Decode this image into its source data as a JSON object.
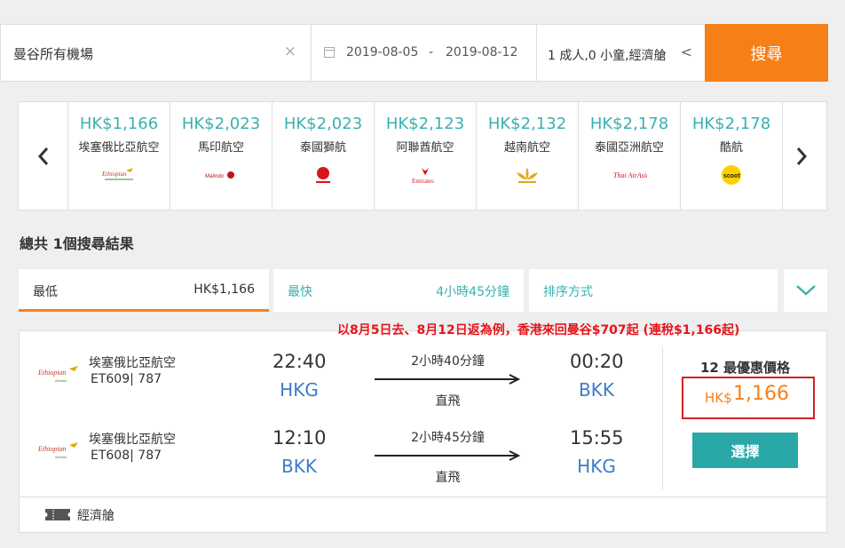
{
  "search": {
    "destination": "曼谷所有機場",
    "clear_symbol": "×",
    "date_from": "2019-08-05",
    "date_separator": "-",
    "date_to": "2019-08-12",
    "passengers": "1 成人,0 小童,經濟艙",
    "passengers_chevron": "<",
    "search_button": "搜尋",
    "accent_color": "#f77f18"
  },
  "carousel": {
    "prev_symbol": "‹",
    "next_symbol": "›",
    "items": [
      {
        "price": "HK$1,166",
        "airline": "埃塞俄比亞航空",
        "logo": "ethiopian-logo"
      },
      {
        "price": "HK$2,023",
        "airline": "馬印航空",
        "logo": "malindo-logo"
      },
      {
        "price": "HK$2,023",
        "airline": "泰國獅航",
        "logo": "thai-lion-logo"
      },
      {
        "price": "HK$2,123",
        "airline": "阿聯酋航空",
        "logo": "emirates-logo"
      },
      {
        "price": "HK$2,132",
        "airline": "越南航空",
        "logo": "vietnam-airlines-logo"
      },
      {
        "price": "HK$2,178",
        "airline": "泰國亞洲航空",
        "logo": "thai-airasia-logo"
      },
      {
        "price": "HK$2,178",
        "airline": "酷航",
        "logo": "scoot-logo"
      }
    ]
  },
  "results": {
    "count_text": "總共 1個搜尋結果"
  },
  "sort_tabs": {
    "cheapest_label": "最低",
    "cheapest_value": "HK$1,166",
    "fastest_label": "最快",
    "fastest_value": "4小時45分鐘",
    "sort_label": "排序方式"
  },
  "annotation": "以8月5日去、8月12日返為例，香港來回曼谷$707起 (連稅$1,166起)",
  "flight": {
    "legs": [
      {
        "airline": "埃塞俄比亞航空",
        "flight_no": "ET609| 787",
        "depart_time": "22:40",
        "depart_airport": "HKG",
        "duration": "2小時40分鐘",
        "stops": "直飛",
        "arrive_time": "00:20",
        "arrive_airport": "BKK"
      },
      {
        "airline": "埃塞俄比亞航空",
        "flight_no": "ET608| 787",
        "depart_time": "12:10",
        "depart_airport": "BKK",
        "duration": "2小時45分鐘",
        "stops": "直飛",
        "arrive_time": "15:55",
        "arrive_airport": "HKG"
      }
    ],
    "deals_text": "12 最優惠價格",
    "price_currency": "HK$",
    "price_amount": "1,166",
    "select_button": "選擇",
    "cabin": "經濟艙"
  }
}
